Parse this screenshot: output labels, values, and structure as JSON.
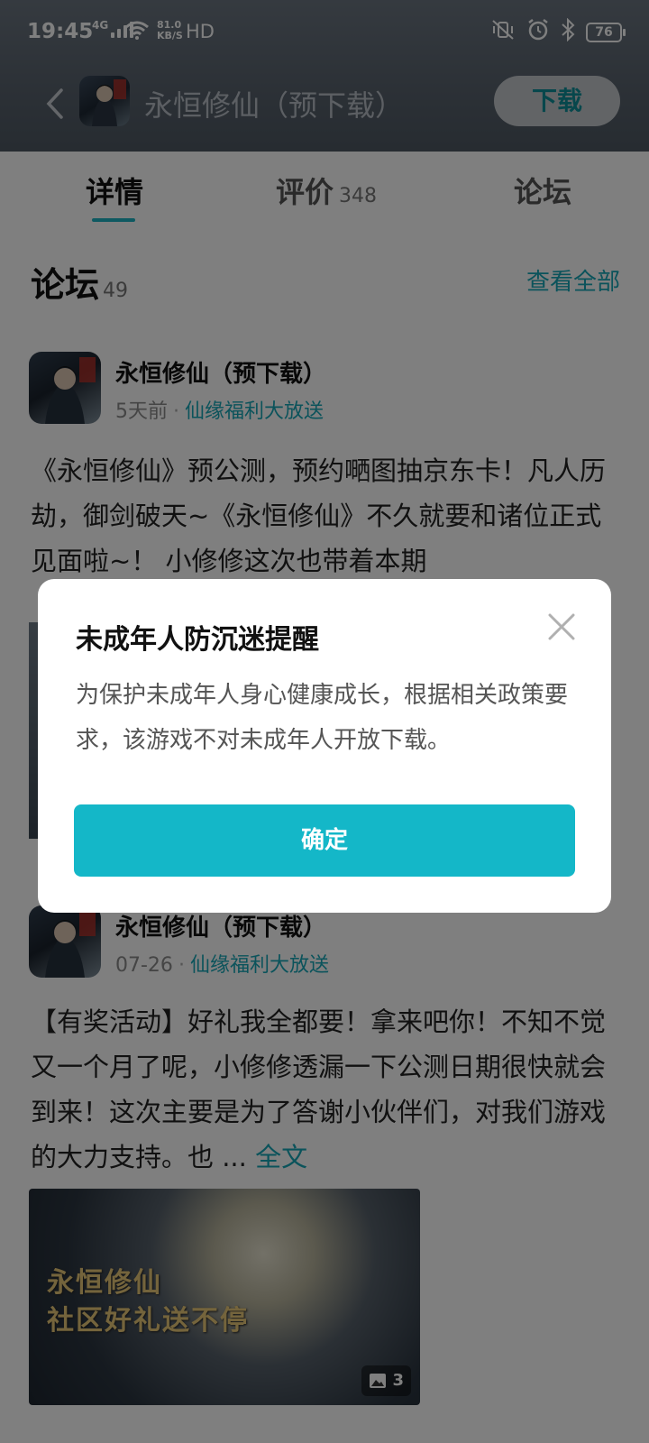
{
  "status_bar": {
    "time": "19:45",
    "network": "4G",
    "speed_top": "81.0",
    "speed_bottom": "KB/S",
    "hd": "HD",
    "battery": "76"
  },
  "nav": {
    "title": "永恒修仙（预下载）",
    "download_label": "下载"
  },
  "tabs": [
    {
      "label": "详情",
      "count": ""
    },
    {
      "label": "评价",
      "count": "348"
    },
    {
      "label": "论坛",
      "count": ""
    }
  ],
  "forum": {
    "title": "论坛",
    "count": "49",
    "view_all": "查看全部"
  },
  "posts": [
    {
      "author": "永恒修仙（预下载）",
      "time": "5天前",
      "topic": "仙缘福利大放送",
      "text": "《永恒修仙》预公测，预约嗮图抽京东卡！凡人历劫，御剑破天~《永恒修仙》不久就要和诸位正式见面啦~！ 小修修这次也带着本期"
    },
    {
      "author": "永恒修仙（预下载）",
      "time": "07-26",
      "topic": "仙缘福利大放送",
      "text": "【有奖活动】好礼我全都要！拿来吧你！不知不觉又一个月了呢，小修修透漏一下公测日期很快就会到来！这次主要是为了答谢小伙伴们，对我们游戏的大力支持。也 ... ",
      "more": "全文",
      "image_text_1": "永恒修仙",
      "image_text_2": "社区好礼送不停",
      "image_count": "3"
    }
  ],
  "dialog": {
    "title": "未成年人防沉迷提醒",
    "message": "为保护未成年人身心健康成长，根据相关政策要求，该游戏不对未成年人开放下载。",
    "confirm_label": "确定"
  },
  "colors": {
    "accent": "#14b7c8",
    "link": "#16a6b6",
    "overlay": "rgba(0,0,0,0.5)"
  }
}
